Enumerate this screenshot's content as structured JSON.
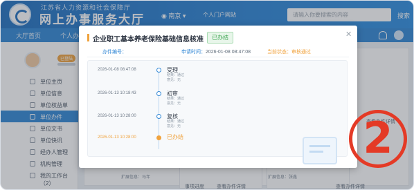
{
  "header": {
    "site_subtitle": "江苏省人力资源和社会保障厅",
    "site_title": "网上办事服务大厅",
    "city": "南京",
    "portal_link": "个人门户网站",
    "search_placeholder": "请输入你要搜索的内容",
    "search_button": "搜索"
  },
  "nav": {
    "items": [
      "大厅首页",
      "个人办"
    ]
  },
  "sidebar": {
    "badge": "已登陆",
    "items": [
      {
        "label": "单位主页"
      },
      {
        "label": "单位信息"
      },
      {
        "label": "单位权益单"
      },
      {
        "label": "单位办件"
      },
      {
        "label": "单位文书"
      },
      {
        "label": "单位快讯"
      },
      {
        "label": "经办人管理"
      },
      {
        "label": "机构管理"
      },
      {
        "label": "我的工作台（2）"
      }
    ],
    "active_index": 3
  },
  "background": {
    "panel_labels": [
      "事项进度",
      "查看办件详情",
      "查看办件详情",
      "扩展信息：马年",
      "扩展信息：张鑫",
      "查看办件详情"
    ]
  },
  "modal": {
    "title": "企业职工基本养老保险基础信息核准",
    "status_tag": "已办结",
    "info": {
      "case_no_label": "办件编号：",
      "case_no_value": "",
      "apply_time_label": "申请时间：",
      "apply_time_value": "2026-01-08 08:47:08",
      "status_label": "当前状态：",
      "status_value": "审核通过"
    },
    "timeline": [
      {
        "time": "2026-01-08 08:47:08",
        "step": "受理",
        "result": "结果：通过",
        "opinion": "意见：无"
      },
      {
        "time": "2026-01-13 10:18:43",
        "step": "初审",
        "result": "结果：通过",
        "opinion": "意见：无"
      },
      {
        "time": "2026-01-13 10:28:00",
        "step": "复核",
        "result": "结果：通过",
        "opinion": "意见：无"
      },
      {
        "time": "2026-01-13 10:28:00",
        "step": "已办结",
        "result": "",
        "opinion": ""
      }
    ]
  },
  "annotation": {
    "number": "2"
  },
  "colors": {
    "brand_blue": "#2f86d5",
    "accent_orange": "#f0a23c",
    "done_green": "#3fa653",
    "annotation_red": "#e43a26"
  }
}
